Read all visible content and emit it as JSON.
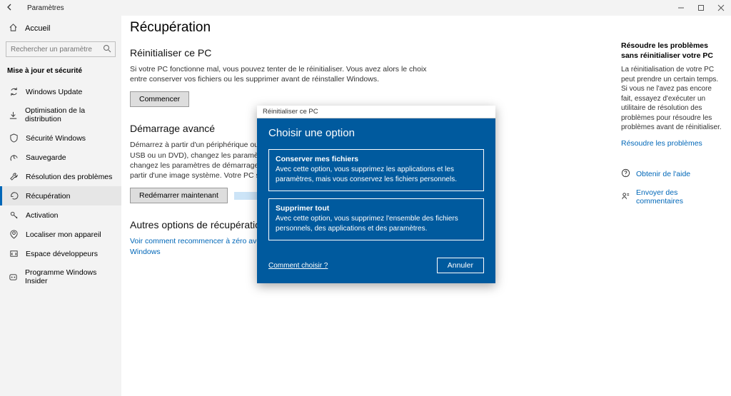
{
  "window": {
    "title": "Paramètres",
    "home": "Accueil",
    "search_placeholder": "Rechercher un paramètre",
    "group": "Mise à jour et sécurité"
  },
  "nav": {
    "items": [
      {
        "label": "Windows Update"
      },
      {
        "label": "Optimisation de la distribution"
      },
      {
        "label": "Sécurité Windows"
      },
      {
        "label": "Sauvegarde"
      },
      {
        "label": "Résolution des problèmes"
      },
      {
        "label": "Récupération"
      },
      {
        "label": "Activation"
      },
      {
        "label": "Localiser mon appareil"
      },
      {
        "label": "Espace développeurs"
      },
      {
        "label": "Programme Windows Insider"
      }
    ]
  },
  "main": {
    "title": "Récupération",
    "reset": {
      "heading": "Réinitialiser ce PC",
      "desc": "Si votre PC fonctionne mal, vous pouvez tenter de le réinitialiser. Vous avez alors le choix entre conserver vos fichiers ou les supprimer avant de réinstaller Windows.",
      "button": "Commencer"
    },
    "advanced": {
      "heading": "Démarrage avancé",
      "desc": "Démarrez à partir d'un périphérique ou d'un disque (par exemple, un lecteur USB ou un DVD), changez les paramètres de microprogramme de votre PC, changez les paramètres de démarrage de Windows ou restaurez Windows à partir d'une image système. Votre PC sera redémarré.",
      "button": "Redémarrer maintenant"
    },
    "other": {
      "heading": "Autres options de récupération",
      "link": "Voir comment recommencer à zéro avec une nouvelle installation de Windows"
    }
  },
  "right": {
    "help_title": "Résoudre les problèmes sans réinitialiser votre PC",
    "help_body": "La réinitialisation de votre PC peut prendre un certain temps. Si vous ne l'avez pas encore fait, essayez d'exécuter un utilitaire de résolution des problèmes pour résoudre les problèmes avant de réinitialiser.",
    "help_link": "Résoudre les problèmes",
    "get_help": "Obtenir de l'aide",
    "feedback": "Envoyer des commentaires"
  },
  "dialog": {
    "title": "Réinitialiser ce PC",
    "heading": "Choisir une option",
    "opt1_title": "Conserver mes fichiers",
    "opt1_desc": "Avec cette option, vous supprimez les applications et les paramètres, mais vous conservez les fichiers personnels.",
    "opt2_title": "Supprimer tout",
    "opt2_desc": "Avec cette option, vous supprimez l'ensemble des fichiers personnels, des applications et des paramètres.",
    "help": "Comment choisir ?",
    "cancel": "Annuler"
  }
}
